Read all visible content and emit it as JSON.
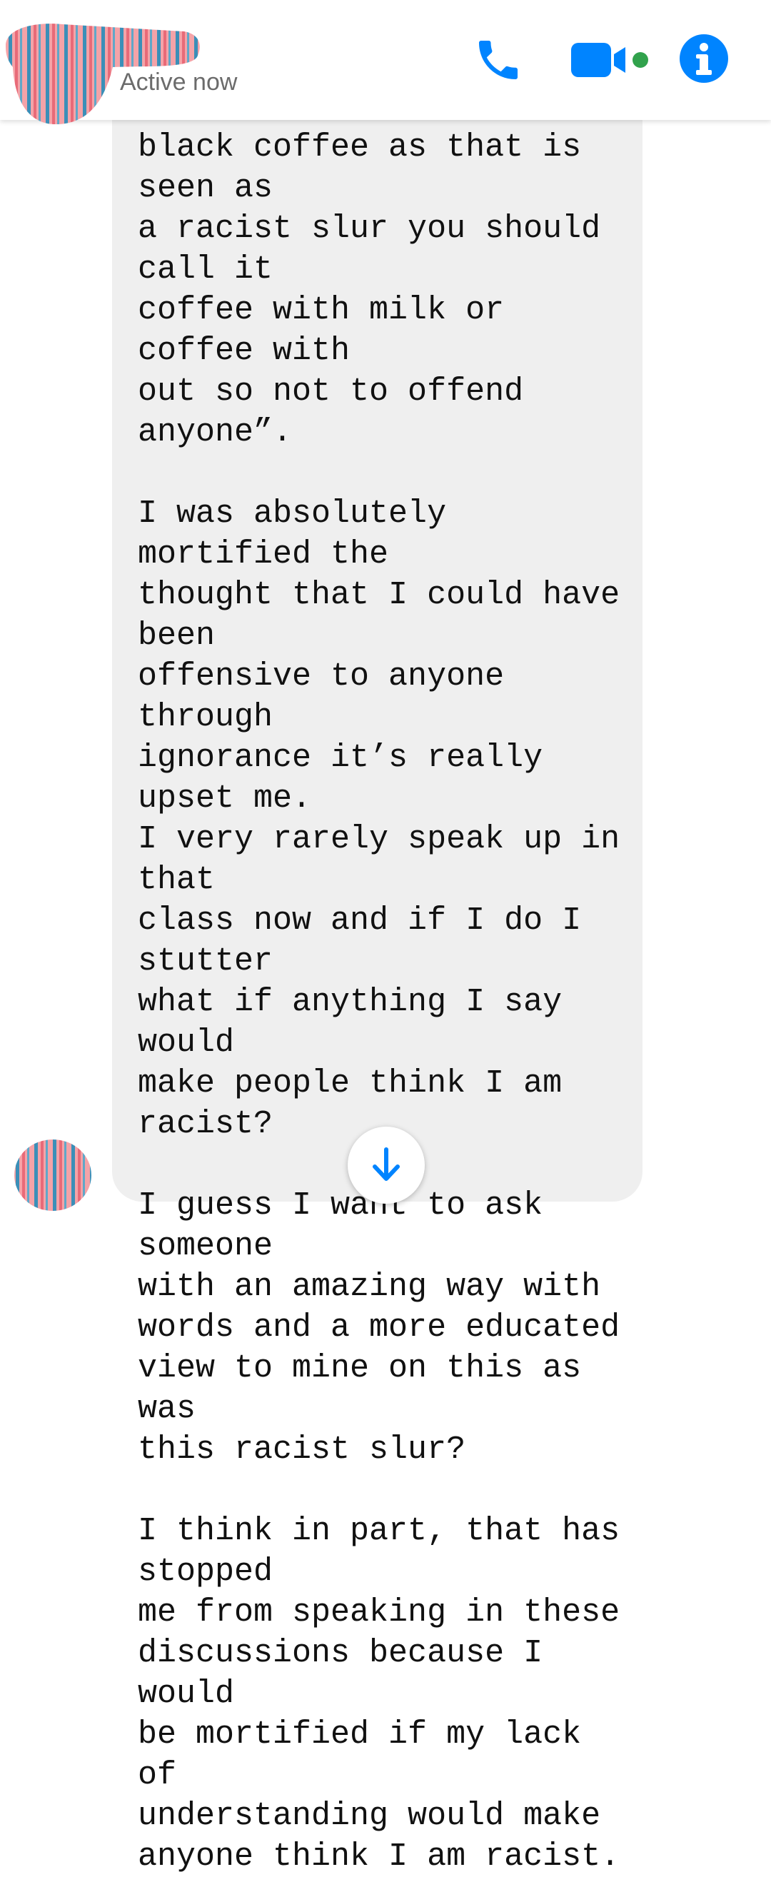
{
  "header": {
    "status": "Active now",
    "icons": {
      "call": "phone-icon",
      "video": "video-camera-icon",
      "info": "info-icon"
    },
    "active_dot_color": "#31a24c",
    "accent_color": "#0084ff"
  },
  "message": {
    "text": "black coffee as that is seen as\na racist slur you should call it\ncoffee with milk or coffee with\nout so not to offend anyone”.\n\nI was absolutely mortified the\nthought that I could have been\noffensive to anyone through\nignorance it’s really upset me.\nI very rarely speak up in that\nclass now and if I do I stutter\nwhat if anything I say would\nmake people think I am racist?\n\nI guess I want to ask someone\nwith an amazing way with\nwords and a more educated\nview to mine on this as was\nthis racist slur?\n\nI think in part, that has stopped\nme from speaking in these\ndiscussions because I would\nbe mortified if my lack of\nunderstanding would make\nanyone think I am racist."
  },
  "scroll_button": {
    "icon": "arrow-down-icon"
  }
}
